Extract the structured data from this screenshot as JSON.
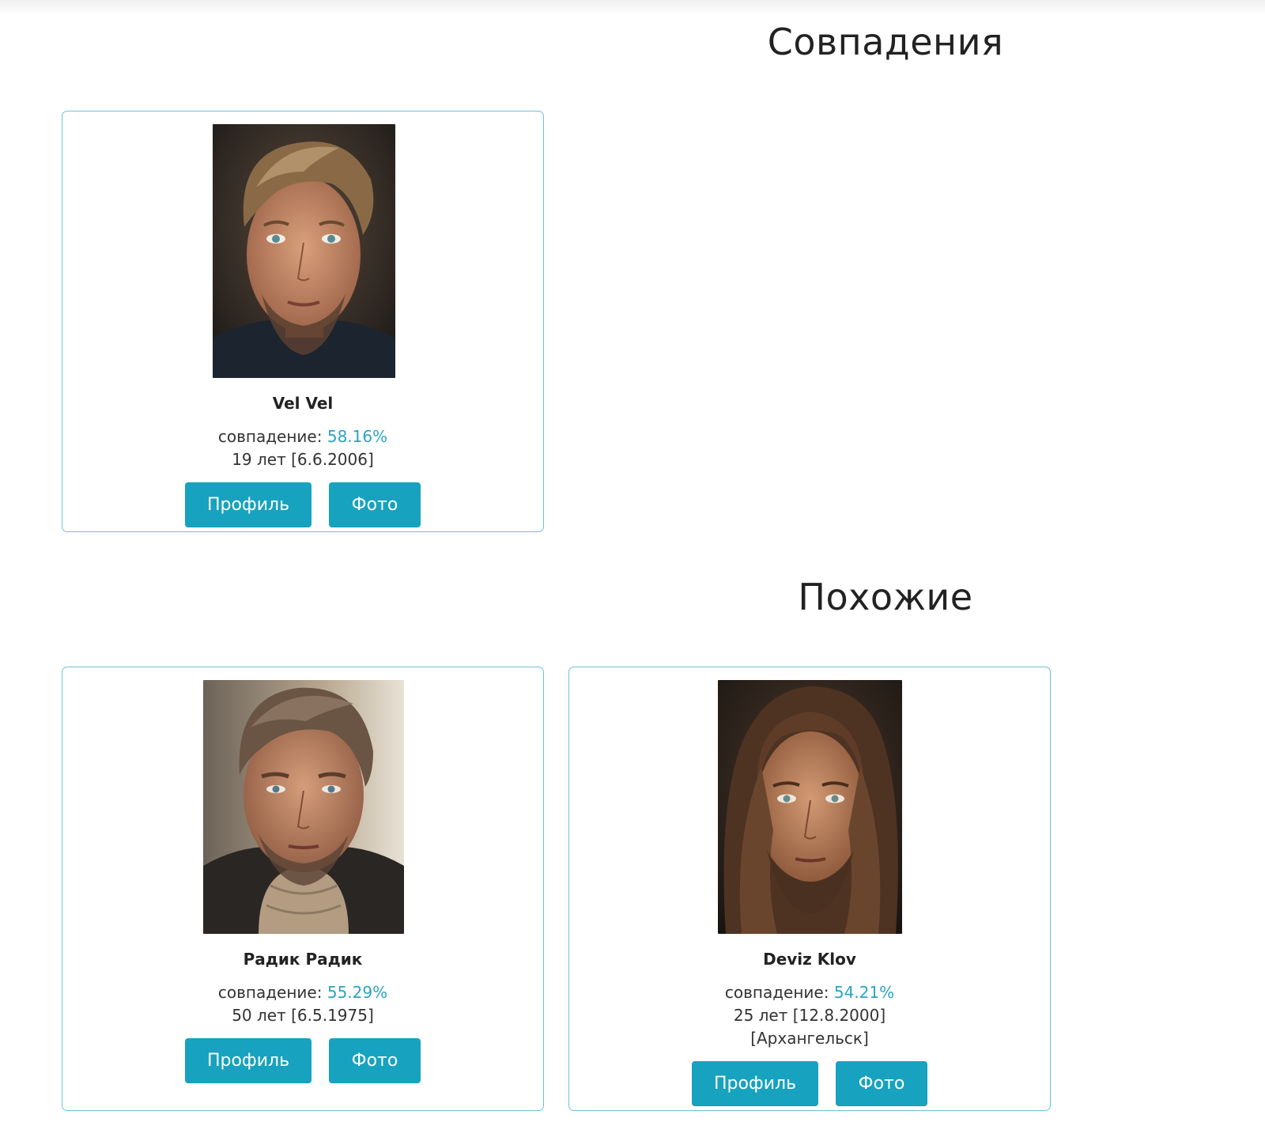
{
  "sections": {
    "matches_title": "Совпадения",
    "similar_title": "Похожие"
  },
  "labels": {
    "match_prefix": "совпадение: ",
    "profile_button": "Профиль",
    "photo_button": "Фото"
  },
  "colors": {
    "accent": "#17a2bf",
    "percent_text": "#2aa4c0",
    "card_border": "#6cc4d6"
  },
  "matches": [
    {
      "name": "Vel Vel",
      "match_percent": "58.16%",
      "age_line": "19 лет [6.6.2006]",
      "city": "",
      "photo": "man-portrait-short-blond-hair-beard"
    }
  ],
  "similar": [
    {
      "name": "Радик Радик",
      "match_percent": "55.29%",
      "age_line": "50 лет [6.5.1975]",
      "city": "",
      "photo": "man-portrait-turtleneck-sweater"
    },
    {
      "name": "Deviz Klov",
      "match_percent": "54.21%",
      "age_line": "25 лет [12.8.2000]",
      "city": "[Архангельск]",
      "photo": "man-portrait-long-hair-beard"
    }
  ]
}
